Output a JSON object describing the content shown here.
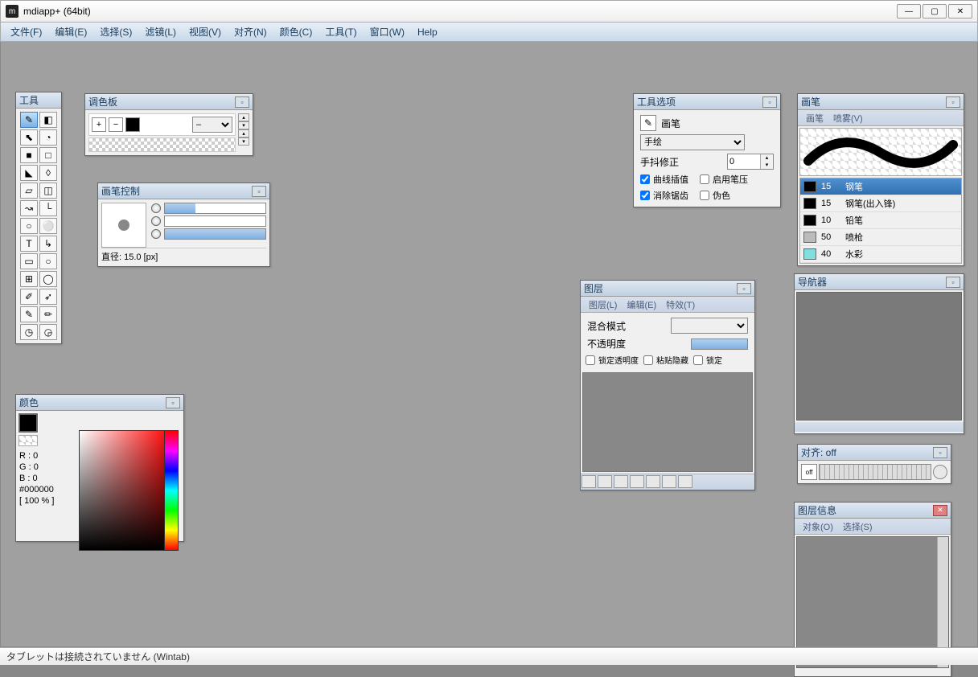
{
  "window": {
    "title": "mdiapp+ (64bit)",
    "icon_letter": "m"
  },
  "menubar": [
    "文件(F)",
    "编辑(E)",
    "选择(S)",
    "滤镜(L)",
    "视图(V)",
    "对齐(N)",
    "颜色(C)",
    "工具(T)",
    "窗口(W)",
    "Help"
  ],
  "panels": {
    "tools": {
      "title": "工具"
    },
    "palette": {
      "title": "调色板",
      "combo_value": "–"
    },
    "brush_control": {
      "title": "画笔控制",
      "status": "直径: 15.0 [px]",
      "slider_fills": [
        30,
        0,
        100
      ]
    },
    "color": {
      "title": "颜色",
      "r": "R : 0",
      "g": "G : 0",
      "b": "B : 0",
      "hex": "#000000",
      "opacity": "[ 100 % ]"
    },
    "tool_options": {
      "title": "工具选项",
      "current_tool": "画笔",
      "style": "手绘",
      "jitter_label": "手抖修正",
      "jitter_value": "0",
      "checks": [
        {
          "label": "曲线插值",
          "checked": true
        },
        {
          "label": "启用笔压",
          "checked": false
        },
        {
          "label": "消除锯齿",
          "checked": true
        },
        {
          "label": "伪色",
          "checked": false
        }
      ]
    },
    "brush": {
      "title": "画笔",
      "menu": [
        "画笔",
        "喷雾(V)"
      ],
      "brushes": [
        {
          "size": "15",
          "name": "钢笔",
          "color": "#000",
          "selected": true
        },
        {
          "size": "15",
          "name": "钢笔(出入锋)",
          "color": "#000",
          "selected": false
        },
        {
          "size": "10",
          "name": "铅笔",
          "color": "#000",
          "selected": false
        },
        {
          "size": "50",
          "name": "喷枪",
          "color": "#bbb",
          "selected": false
        },
        {
          "size": "40",
          "name": "水彩",
          "color": "#7fe0e0",
          "selected": false
        }
      ]
    },
    "layers": {
      "title": "图层",
      "menu": [
        "图层(L)",
        "编辑(E)",
        "特效(T)"
      ],
      "blend_label": "混合模式",
      "opacity_label": "不透明度",
      "check_labels": [
        "锁定透明度",
        "粘贴隐藏",
        "锁定"
      ]
    },
    "navigator": {
      "title": "导航器"
    },
    "align": {
      "title": "对齐: off",
      "mode": "off"
    },
    "layer_info": {
      "title": "图层信息",
      "menu": [
        "对象(O)",
        "选择(S)"
      ]
    }
  },
  "statusbar": "タブレットは接続されていません (Wintab)",
  "tool_icons": [
    "✎",
    "◧",
    "⬉",
    "◔",
    "■",
    "□",
    "◣",
    "◊",
    "▱",
    "◫",
    "↝",
    "└",
    "○",
    "⚪",
    "T",
    "↳",
    "▭",
    "○",
    "⊞",
    "◯",
    "✐",
    "➶",
    "✎",
    "✏",
    "◷",
    "◶"
  ]
}
